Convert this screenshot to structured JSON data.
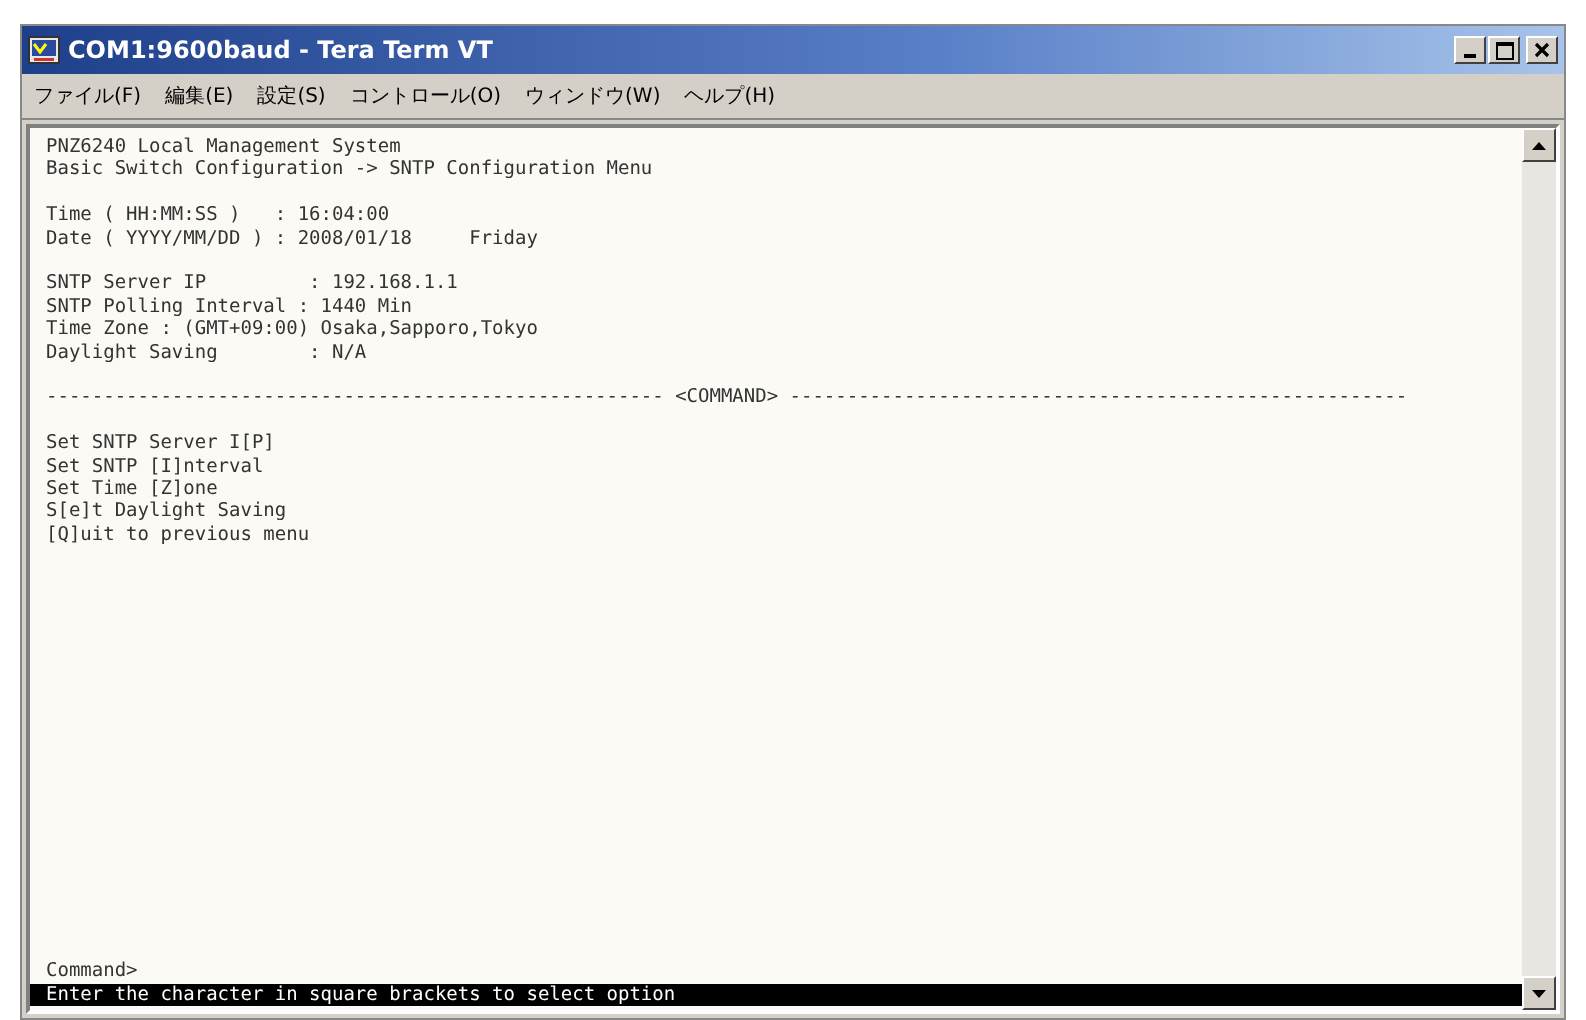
{
  "window": {
    "title": "COM1:9600baud - Tera Term VT"
  },
  "menu": [
    "ファイル(F)",
    "編集(E)",
    "設定(S)",
    "コントロール(O)",
    "ウィンドウ(W)",
    "ヘルプ(H)"
  ],
  "terminal": {
    "blocks": [
      [
        "PNZ6240 Local Management System",
        "Basic Switch Configuration -> SNTP Configuration Menu"
      ],
      [
        "Time ( HH:MM:SS )   : 16:04:00",
        "Date ( YYYY/MM/DD ) : 2008/01/18     Friday"
      ],
      [
        "SNTP Server IP         : 192.168.1.1",
        "SNTP Polling Interval : 1440 Min",
        "Time Zone : (GMT+09:00) Osaka,Sapporo,Tokyo",
        "Daylight Saving        : N/A"
      ],
      [
        "------------------------------------------------------ <COMMAND> ------------------------------------------------------"
      ],
      [
        "Set SNTP Server I[P]",
        "Set SNTP [I]nterval",
        "Set Time [Z]one",
        "S[e]t Daylight Saving",
        "[Q]uit to previous menu"
      ]
    ],
    "prompt": "Command>",
    "status_line": "Enter the character in square brackets to select option"
  }
}
